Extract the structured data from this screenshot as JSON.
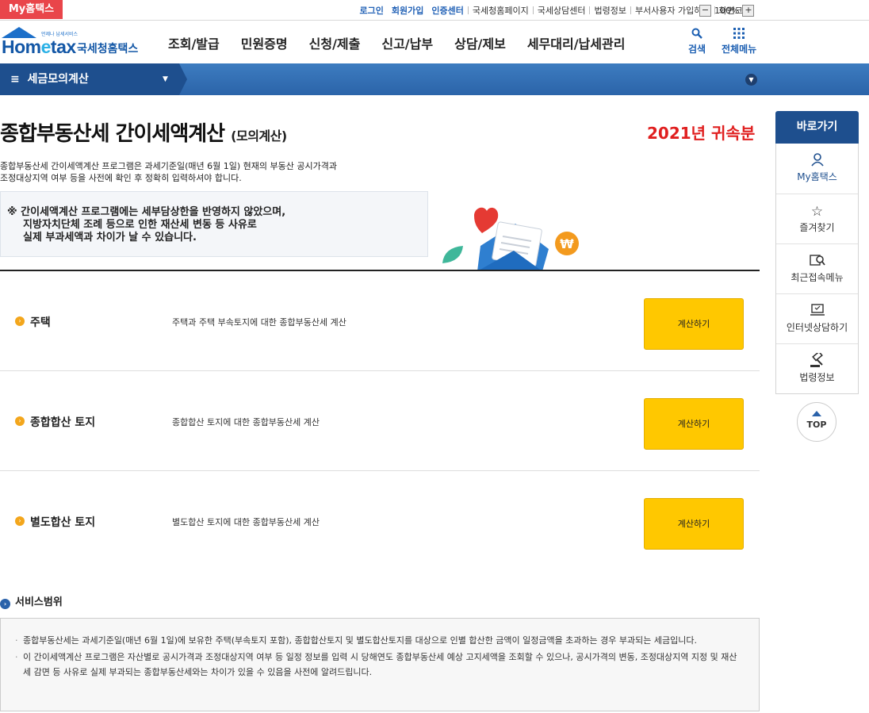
{
  "topbar": {
    "my_badge": "My홈택스",
    "links": [
      {
        "label": "로그인",
        "style": "blue"
      },
      {
        "label": "회원가입",
        "style": "blue"
      },
      {
        "label": "인증센터",
        "style": "blue"
      },
      {
        "label": "국세청홈페이지",
        "style": "plain"
      },
      {
        "label": "국세상담센터",
        "style": "plain"
      },
      {
        "label": "법령정보",
        "style": "plain"
      },
      {
        "label": "부서사용자 가입하기",
        "style": "plain"
      },
      {
        "label": "화면크기",
        "style": "plain"
      }
    ],
    "zoom_minus": "−",
    "zoom_value": "100%",
    "zoom_plus": "+"
  },
  "header": {
    "logo_small": "언제나 납세서비스",
    "logo_brand_a": "Hom",
    "logo_brand_e": "e",
    "logo_brand_b": "tax",
    "logo_kor": "국세청홈택스",
    "nav": [
      "조회/발급",
      "민원증명",
      "신청/제출",
      "신고/납부",
      "상담/제보",
      "세무대리/납세관리"
    ],
    "search_label": "검색",
    "allmenu_label": "전체메뉴"
  },
  "bluebar": {
    "menu_label": "세금모의계산"
  },
  "main": {
    "title": "종합부동산세 간이세액계산",
    "title_suffix": "(모의계산)",
    "year_label": "2021년 귀속분",
    "desc_line1": "종합부동산세 간이세액계산 프로그램은 과세기준일(매년 6월 1일) 현재의 부동산 공시가격과",
    "desc_line2": "조정대상지역 여부 등을 사전에 확인 후 정확히 입력하셔야 합니다.",
    "notice_line1": "※ 간이세액계산 프로그램에는 세부담상한을 반영하지 않았으며,",
    "notice_line2": "지방자치단체 조례 등으로 인한 재산세 변동 등 사유로",
    "notice_line3": "실제 부과세액과 차이가 날 수 있습니다.",
    "illus_won_symbol": "₩",
    "rows": [
      {
        "name": "주택",
        "desc": "주택과 주택 부속토지에 대한 종합부동산세 계산",
        "button": "계산하기"
      },
      {
        "name": "종합합산 토지",
        "desc": "종합합산 토지에 대한 종합부동산세 계산",
        "button": "계산하기"
      },
      {
        "name": "별도합산 토지",
        "desc": "별도합산 토지에 대한 종합부동산세 계산",
        "button": "계산하기"
      }
    ],
    "service_title": "서비스범위",
    "service_items": [
      "종합부동산세는 과세기준일(매년 6월 1일)에 보유한 주택(부속토지 포함), 종합합산토지 및 별도합산토지를 대상으로 인별 합산한 금액이 일정금액을 초과하는 경우 부과되는 세금입니다.",
      "이 간이세액계산 프로그램은 자산별로 공시가격과 조정대상지역 여부 등 일정 정보를 입력 시 당해연도 종합부동산세 예상 고지세액을 조회할 수 있으나, 공시가격의 변동, 조정대상지역 지정 및 재산세 감면 등 사유로 실제 부과되는 종합부동산세와는 차이가 있을 수 있음을 사전에 알려드립니다."
    ]
  },
  "quick": {
    "title": "바로가기",
    "items": [
      "My홈택스",
      "즐겨찾기",
      "최근접속메뉴",
      "인터넷상담하기",
      "법령정보"
    ],
    "top_label": "TOP"
  },
  "colors": {
    "accent_red": "#e01f1f",
    "nav_blue": "#1e4f8e",
    "button_yellow": "#ffc800",
    "badge_red": "#e9454a"
  },
  "icons": [
    "search-icon",
    "grid-icon",
    "chevron-down-icon",
    "person-icon",
    "star-icon",
    "recent-search-icon",
    "monitor-chat-icon",
    "gavel-icon",
    "arrow-up-icon",
    "heart-icon",
    "envelope-icon",
    "leaf-icon",
    "won-coin-icon"
  ]
}
